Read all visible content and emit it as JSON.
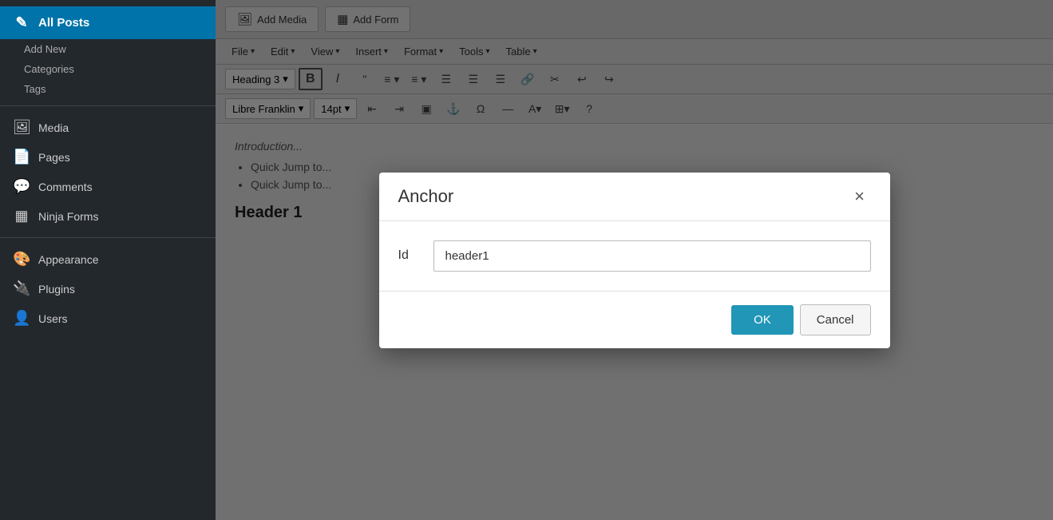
{
  "sidebar": {
    "items": [
      {
        "id": "all-posts",
        "label": "All Posts",
        "icon": "✎",
        "active": true,
        "top": true
      },
      {
        "id": "add-new",
        "label": "Add New",
        "icon": "",
        "sub": true
      },
      {
        "id": "categories",
        "label": "Categories",
        "icon": "",
        "sub": true
      },
      {
        "id": "tags",
        "label": "Tags",
        "icon": "",
        "sub": true
      },
      {
        "id": "media",
        "label": "Media",
        "icon": "🖼",
        "section": true
      },
      {
        "id": "pages",
        "label": "Pages",
        "icon": "📄",
        "section": true
      },
      {
        "id": "comments",
        "label": "Comments",
        "icon": "💬",
        "section": true
      },
      {
        "id": "ninja-forms",
        "label": "Ninja Forms",
        "icon": "▦",
        "section": true
      },
      {
        "id": "appearance",
        "label": "Appearance",
        "icon": "🎨",
        "section": true
      },
      {
        "id": "plugins",
        "label": "Plugins",
        "icon": "🔌",
        "section": true
      },
      {
        "id": "users",
        "label": "Users",
        "icon": "👤",
        "section": true
      }
    ]
  },
  "toolbar": {
    "add_media_label": "Add Media",
    "add_form_label": "Add Form",
    "menus": [
      {
        "id": "file",
        "label": "File"
      },
      {
        "id": "edit",
        "label": "Edit"
      },
      {
        "id": "view",
        "label": "View"
      },
      {
        "id": "insert",
        "label": "Insert"
      },
      {
        "id": "format",
        "label": "Format"
      },
      {
        "id": "tools",
        "label": "Tools"
      },
      {
        "id": "table",
        "label": "Table"
      }
    ],
    "heading_select": "Heading 3",
    "font_select": "Libre Franklin",
    "font_size": "14pt"
  },
  "editor": {
    "intro_text": "Introduction...",
    "list_items": [
      "Quick Jump to...",
      "Quick Jump to..."
    ],
    "header1_text": "Header 1"
  },
  "modal": {
    "title": "Anchor",
    "close_label": "×",
    "id_label": "Id",
    "id_value": "header1",
    "ok_label": "OK",
    "cancel_label": "Cancel"
  }
}
